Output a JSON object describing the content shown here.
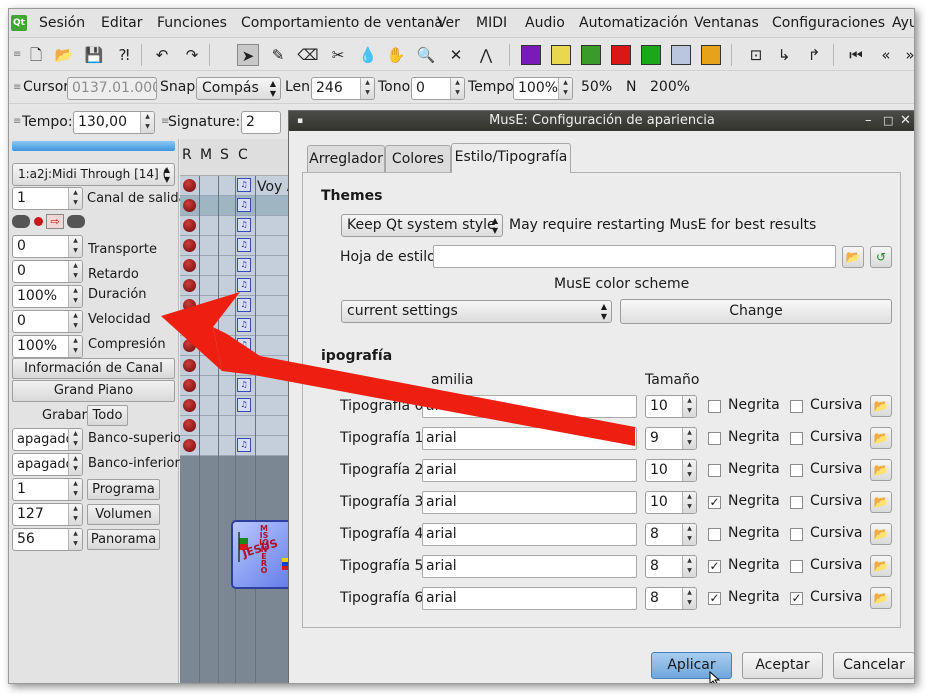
{
  "menubar": {
    "logo": "Qt",
    "items": [
      "Sesión",
      "Editar",
      "Funciones",
      "Comportamiento de ventana",
      "Ver",
      "MIDI",
      "Audio",
      "Automatización",
      "Ventanas",
      "Configuraciones",
      "Ayu"
    ]
  },
  "toolbar2": {
    "cursor_label": "Cursor",
    "cursor_value": "0137.01.000",
    "snap_label": "Snap",
    "snap_value": "Compás",
    "len_label": "Len",
    "len_value": "246",
    "tono_label": "Tono",
    "tono_value": "0",
    "tempo_label": "Tempo",
    "tempo_value": "100%",
    "preset_50": "50%",
    "preset_n": "N",
    "preset_200": "200%"
  },
  "toolbar3": {
    "tempo_label": "Tempo:",
    "tempo_value": "130,00",
    "signature_label": "Signature:",
    "signature_value": "2"
  },
  "strip": {
    "port": "1:a2j:Midi Through [14] (",
    "canal_value": "1",
    "canal_label": "Canal de salida",
    "transporte_value": "0",
    "transporte_label": "Transporte",
    "retardo_value": "0",
    "retardo_label": "Retardo",
    "duracion_value": "100%",
    "duracion_label": "Duración",
    "velocidad_value": "0",
    "velocidad_label": "Velocidad",
    "compresion_value": "100%",
    "compresion_label": "Compresión",
    "info_canal": "Información de Canal",
    "instrument": "Grand Piano",
    "grabar_label": "Grabar",
    "todo_label": "Todo",
    "banco_sup_value": "apagado",
    "banco_sup_label": "Banco-superior",
    "banco_inf_value": "apagado",
    "banco_inf_label": "Banco-inferior",
    "programa_value": "1",
    "programa_label": "Programa",
    "volumen_value": "127",
    "volumen_label": "Volumen",
    "panorama_value": "56",
    "panorama_label": "Panorama"
  },
  "tracks": {
    "headers": [
      "R",
      "M",
      "S",
      "C"
    ],
    "first_track_name": "Voy A",
    "rows": 14
  },
  "dialog": {
    "title": "MusE: Configuración de apariencia",
    "tabs": [
      "Arreglador",
      "Colores",
      "Estilo/Tipografía"
    ],
    "themes_heading": "Themes",
    "theme_value": "Keep Qt system style",
    "theme_note": "May require restarting MusE for best results",
    "stylesheet_label": "Hoja de estilo",
    "stylesheet_value": "",
    "color_scheme_label": "MusE color scheme",
    "color_scheme_value": "current settings",
    "change_button": "Change",
    "typography_heading": "ipografía",
    "family_header": "amilia",
    "size_header": "Tamaño",
    "bold_label": "Negrita",
    "italic_label": "Cursiva",
    "fonts": [
      {
        "label": "Tipografía 0",
        "family": "arial",
        "size": "10",
        "bold": false,
        "italic": false
      },
      {
        "label": "Tipografía 1",
        "family": "arial",
        "size": "9",
        "bold": false,
        "italic": false
      },
      {
        "label": "Tipografía 2",
        "family": "arial",
        "size": "10",
        "bold": false,
        "italic": false
      },
      {
        "label": "Tipografía 3",
        "family": "arial",
        "size": "10",
        "bold": true,
        "italic": false
      },
      {
        "label": "Tipografía 4",
        "family": "arial",
        "size": "8",
        "bold": false,
        "italic": false
      },
      {
        "label": "Tipografía 5",
        "family": "arial",
        "size": "8",
        "bold": true,
        "italic": false
      },
      {
        "label": "Tipografía 6",
        "family": "arial",
        "size": "8",
        "bold": true,
        "italic": true
      }
    ],
    "apply_button": "Aplicar",
    "accept_button": "Aceptar",
    "cancel_button": "Cancelar"
  },
  "sticker": {
    "text_vertical": "MISIONERO",
    "text_horizontal": "JESÚS"
  },
  "colors": {
    "arrow": "#ee1f10",
    "record": "#8a1515",
    "apply": "#7fb2e5"
  }
}
